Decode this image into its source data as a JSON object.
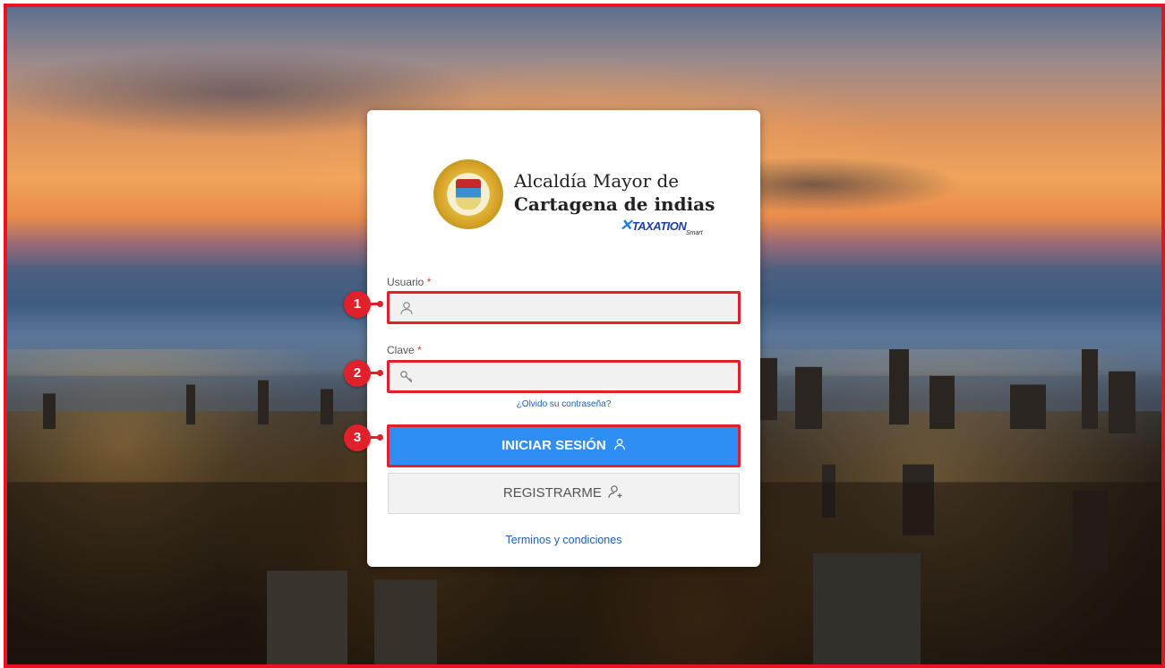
{
  "organization": {
    "line1": "Alcaldía Mayor de",
    "line2": "Cartagena de indias"
  },
  "brand": {
    "name": "TAXATION",
    "sub": "Smart"
  },
  "form": {
    "user_label": "Usuario",
    "password_label": "Clave",
    "required_mark": "*",
    "forgot_password": "¿Olvido su contraseña?",
    "login_button": "INICIAR SESIÓN",
    "register_button": "REGISTRARME",
    "terms_link": "Terminos y condiciones"
  },
  "callouts": [
    "1",
    "2",
    "3"
  ],
  "colors": {
    "highlight": "#e0202a",
    "primary_button": "#2f8ef4",
    "link": "#1f5fb5"
  },
  "icons": {
    "user_field": "user-icon",
    "password_field": "key-icon",
    "login": "user-icon",
    "register": "user-plus-icon"
  }
}
